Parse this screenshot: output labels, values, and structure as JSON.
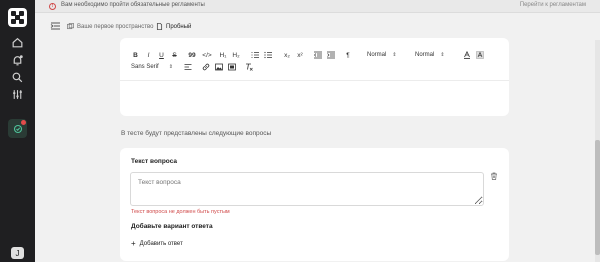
{
  "notice": {
    "message": "Вам необходимо пройти обязательные регламенты",
    "link": "Перейти к регламентам"
  },
  "breadcrumb": {
    "workspace": "Ваше первое пространство",
    "current": "Пробный"
  },
  "editor": {
    "toolbar": {
      "bold": "B",
      "italic": "I",
      "underline": "U",
      "strike": "S",
      "quote": "99",
      "code": "</>",
      "h1": "H₁",
      "h2": "H₂",
      "subscript": "x₂",
      "superscript": "x²",
      "direction": "¶",
      "header_select": "Normal",
      "size_select": "Normal",
      "font_select": "Sans Serif"
    }
  },
  "section_label": "В тесте будут представлены следующие вопросы",
  "question": {
    "title": "Текст вопроса",
    "placeholder": "Текст вопроса",
    "error": "Текст вопроса не должен быть пустым",
    "answer_title": "Добавьте вариант ответа",
    "add_answer": "Добавить ответ"
  },
  "user": {
    "avatar_initial": "J"
  },
  "colors": {
    "rail": "#1f1f21",
    "accent_active": "#2a3b35",
    "error": "#d04a4a",
    "badge": "#e34b4b"
  }
}
